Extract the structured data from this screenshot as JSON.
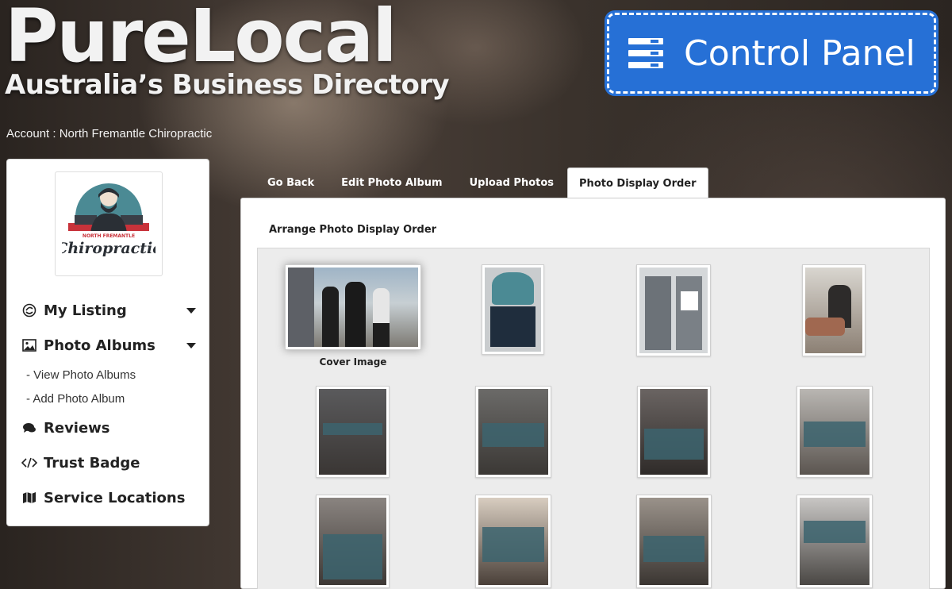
{
  "brand": {
    "title": "PureLocal",
    "subtitle": "Australia’s Business Directory"
  },
  "control_panel": {
    "label": "Control Panel"
  },
  "account": {
    "text": "Account : North Fremantle Chiropractic"
  },
  "sidebar": {
    "menu": [
      {
        "label": "My Listing",
        "icon": "listing-icon",
        "has_caret": true
      },
      {
        "label": "Photo Albums",
        "icon": "image-icon",
        "has_caret": true
      },
      {
        "label": "Reviews",
        "icon": "comments-icon",
        "has_caret": false
      },
      {
        "label": "Trust Badge",
        "icon": "code-icon",
        "has_caret": false
      },
      {
        "label": "Service Locations",
        "icon": "map-icon",
        "has_caret": false
      }
    ],
    "sub_items": [
      {
        "label": "- View Photo Albums"
      },
      {
        "label": "- Add Photo Album"
      }
    ]
  },
  "tabs": [
    {
      "label": "Go Back"
    },
    {
      "label": "Edit Photo Album"
    },
    {
      "label": "Upload Photos"
    },
    {
      "label": "Photo Display Order",
      "active": true
    }
  ],
  "panel": {
    "title": "Arrange Photo Display Order",
    "cover_label": "Cover Image"
  },
  "colors": {
    "accent": "#2670d6",
    "overlay": "#3c646e"
  }
}
